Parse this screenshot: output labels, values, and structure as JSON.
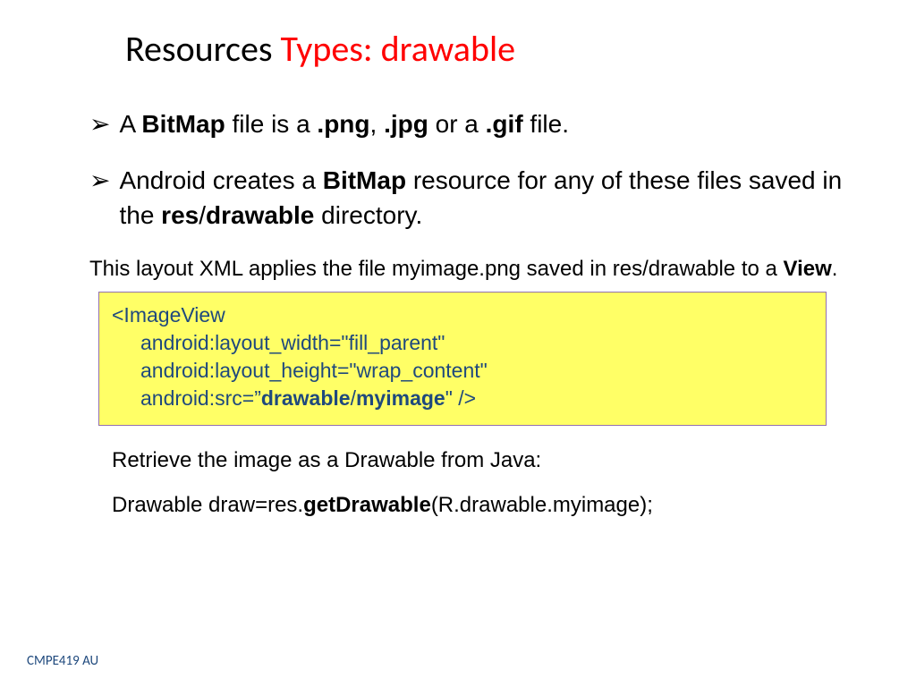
{
  "title": {
    "part1": "Resources ",
    "part2": "Types: drawable"
  },
  "bullets": [
    {
      "pre1": "A ",
      "b1": "BitMap",
      "mid1": " file is a ",
      "b2": ".png",
      "mid2": ", ",
      "b3": ".jpg",
      "mid3": " or a ",
      "b4": ".gif",
      "post": " file."
    },
    {
      "pre1": "Android creates a ",
      "b1": "BitMap",
      "mid1": " resource for any of these files saved in the ",
      "b2": "res",
      "slash": "/",
      "b3": "drawable",
      "post": " directory."
    }
  ],
  "subtext": {
    "pre": "This layout XML applies the file myimage.png saved in res/drawable to a ",
    "b1": "View",
    "post": "."
  },
  "code": {
    "l1": "<ImageView",
    "l2": "android:layout_width=\"fill_parent\"",
    "l3": "android:layout_height=\"wrap_content\"",
    "l4_pre": "android:src=”",
    "l4_b1": "drawable",
    "l4_slash": "/",
    "l4_b2": "myimage",
    "l4_post": "\" />"
  },
  "retrieve": {
    "line1": "Retrieve the image as a Drawable from Java:",
    "line2_pre": "Drawable draw=res.",
    "line2_b": "getDrawable",
    "line2_post": "(R.drawable.myimage);"
  },
  "footer": "CMPE419 AU"
}
